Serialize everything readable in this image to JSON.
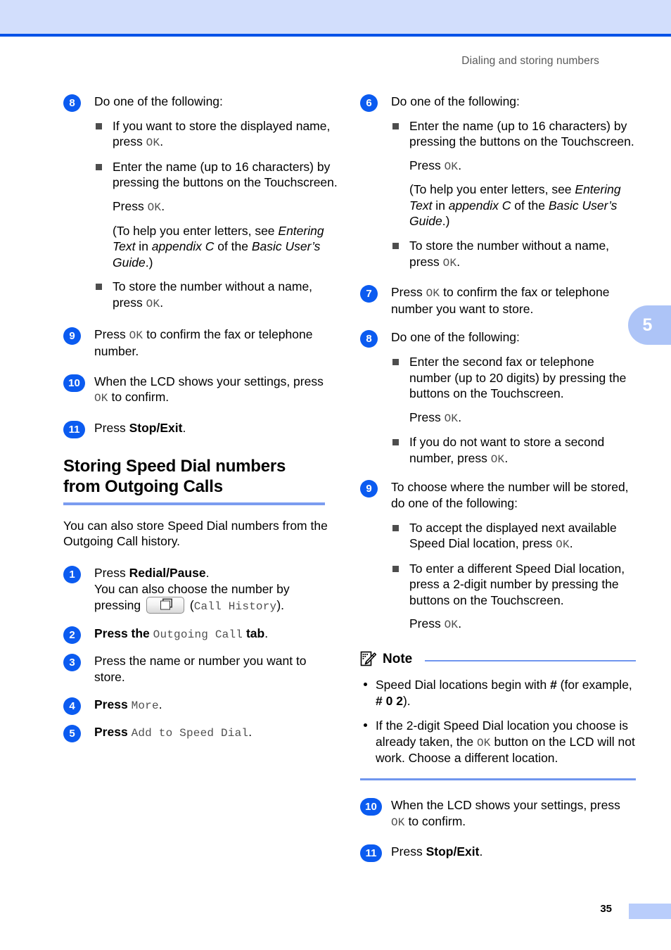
{
  "page": {
    "running_head": "Dialing and storing numbers",
    "folio": "35",
    "chapter_tab": "5",
    "accent_color": "#0b5bf0",
    "band_color": "#d2defc",
    "rule_color": "#0052e8",
    "tab_color": "#adc4f7"
  },
  "left": {
    "step8": {
      "num": "8",
      "lead": "Do one of the following:",
      "b1_a": "If you want to store the displayed",
      "b1_b": "name, press ",
      "b1_ok": "OK",
      "b1_end": ".",
      "b2": "Enter the name (up to 16 characters) by pressing the buttons on the Touchscreen.",
      "b2_press": "Press ",
      "b2_ok": "OK",
      "b2_end": ".",
      "b2_note_1": "(To help you enter letters, see ",
      "b2_note_ital1": "Entering Text",
      "b2_note_2": " in ",
      "b2_note_ital2": "appendix C",
      "b2_note_3": " of the ",
      "b2_note_ital3": "Basic User’s Guide",
      "b2_note_4": ".)",
      "b3_a": "To store the number without a name, press ",
      "b3_ok": "OK",
      "b3_end": "."
    },
    "step9": {
      "num": "9",
      "t1": "Press ",
      "ok": "OK",
      "t2": " to confirm the fax or telephone number."
    },
    "step10": {
      "num": "10",
      "t1": "When the LCD shows your settings, press ",
      "ok": "OK",
      "t2": " to confirm."
    },
    "step11": {
      "num": "11",
      "t1": "Press ",
      "bold": "Stop/Exit",
      "t2": "."
    },
    "section": {
      "heading_line1": "Storing Speed Dial numbers",
      "heading_line2": "from Outgoing Calls",
      "intro": "You can also store Speed Dial numbers from the Outgoing Call history."
    },
    "step1": {
      "num": "1",
      "t1": "Press ",
      "bold": "Redial/Pause",
      "t2": ".",
      "t3": "You can also choose the number by pressing ",
      "icon": "call-history-key",
      "t4": " (",
      "mono": "Call History",
      "t5": ")."
    },
    "step2": {
      "num": "2",
      "t1": "Press the ",
      "mono": "Outgoing Call",
      "t2": " ",
      "bold": "tab",
      "t3": "."
    },
    "step3": {
      "num": "3",
      "t1": "Press the name or number you want to store."
    },
    "step4": {
      "num": "4",
      "bold": "Press",
      "t1": " ",
      "mono": "More",
      "t2": "."
    },
    "step5": {
      "num": "5",
      "bold": "Press",
      "t1": " ",
      "mono": "Add to Speed Dial",
      "t2": "."
    }
  },
  "right": {
    "step6": {
      "num": "6",
      "lead": "Do one of the following:",
      "b1": "Enter the name (up to 16 characters) by pressing the buttons on the Touchscreen.",
      "b1_press": "Press ",
      "b1_ok": "OK",
      "b1_end": ".",
      "note_1": " (To help you enter letters, see ",
      "note_ital1": "Entering Text",
      "note_2": " in ",
      "note_ital2": "appendix C",
      "note_3": " of the ",
      "note_ital3": "Basic User’s Guide",
      "note_4": ".)",
      "b2_a": "To store the number without a name, press ",
      "b2_ok": "OK",
      "b2_end": "."
    },
    "step7": {
      "num": "7",
      "t1": "Press ",
      "ok": "OK",
      "t2": " to confirm the fax or telephone number you want to store."
    },
    "step8": {
      "num": "8",
      "lead": "Do one of the following:",
      "b1": "Enter the second fax or telephone number (up to 20 digits) by pressing the buttons on the Touchscreen.",
      "b1_press": "Press ",
      "b1_ok": "OK",
      "b1_end": ".",
      "b2_a": "If you do not want to store a second number, press ",
      "b2_ok": "OK",
      "b2_end": "."
    },
    "step9": {
      "num": "9",
      "lead": "To choose where the number will be stored, do one of the following:",
      "b1_a": "To accept the displayed next available Speed Dial location, press ",
      "b1_ok": "OK",
      "b1_end": ".",
      "b2": "To enter a different Speed Dial location, press a 2-digit number by pressing the buttons on the Touchscreen.",
      "b2_press": "Press ",
      "b2_ok": "OK",
      "b2_end": "."
    },
    "note": {
      "icon": "note-pencil-icon",
      "title": "Note",
      "item1_a": "Speed Dial locations begin with ",
      "item1_hash": "#",
      "item1_b": " (for example, ",
      "item1_example": "# 0 2",
      "item1_c": ").",
      "item2_a": "If the 2-digit Speed Dial location you choose is already taken, the ",
      "item2_ok": "OK",
      "item2_b": " button on the LCD will not work. Choose a different location."
    },
    "step10": {
      "num": "10",
      "t1": "When the LCD shows your settings, press ",
      "ok": "OK",
      "t2": " to confirm."
    },
    "step11": {
      "num": "11",
      "t1": "Press ",
      "bold": "Stop/Exit",
      "t2": "."
    }
  }
}
